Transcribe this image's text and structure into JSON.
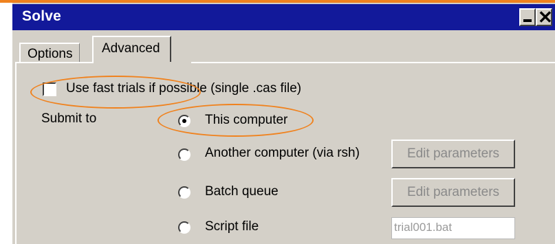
{
  "window": {
    "title": "Solve"
  },
  "tabs": [
    {
      "label": "Options",
      "active": false
    },
    {
      "label": "Advanced",
      "active": true
    }
  ],
  "advanced": {
    "fast_trials_label": "Use fast trials if possible (single .cas file)",
    "fast_trials_checked": false,
    "submit_to_label": "Submit to",
    "options": [
      {
        "label": "This computer",
        "selected": true
      },
      {
        "label": "Another computer (via rsh)",
        "selected": false,
        "button": "Edit parameters"
      },
      {
        "label": "Batch queue",
        "selected": false,
        "button": "Edit parameters"
      },
      {
        "label": "Script file",
        "selected": false,
        "field_value": "trial001.bat"
      }
    ]
  },
  "colors": {
    "titlebar": "#12199a",
    "window_bg": "#d4d0c8",
    "highlight": "#f0821e"
  },
  "icons": {
    "minimize": "minimize-icon",
    "close": "close-icon"
  }
}
